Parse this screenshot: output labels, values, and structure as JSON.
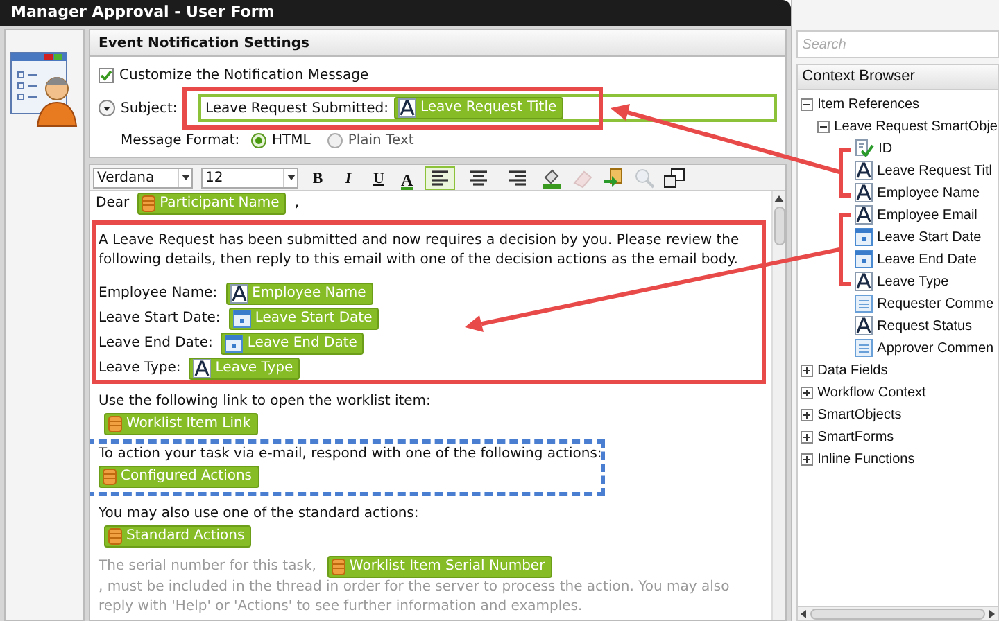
{
  "window": {
    "title": "Manager Approval - User Form"
  },
  "section_title": "Event Notification Settings",
  "customize": {
    "label": "Customize the Notification Message",
    "checked": true
  },
  "subject": {
    "label": "Subject:",
    "prefix": "Leave Request Submitted:",
    "token": {
      "label": "Leave Request Title",
      "kind": "text"
    }
  },
  "message_format": {
    "label": "Message Format:",
    "options": [
      {
        "label": "HTML",
        "selected": true
      },
      {
        "label": "Plain Text",
        "selected": false
      }
    ]
  },
  "toolbar": {
    "font": "Verdana",
    "size": "12",
    "styles": [
      "B",
      "I",
      "U"
    ],
    "color_button": "A",
    "alignment": [
      {
        "selected": true
      },
      {
        "selected": false
      },
      {
        "selected": false
      }
    ],
    "tools": [
      {
        "kind": "fill",
        "disabled": false
      },
      {
        "kind": "eraser",
        "disabled": true
      },
      {
        "kind": "insert",
        "disabled": false
      },
      {
        "kind": "zoom",
        "disabled": true
      },
      {
        "kind": "popout",
        "disabled": false
      }
    ]
  },
  "body": {
    "greeting": "Dear",
    "greeting_token": {
      "label": "Participant Name",
      "kind": "data"
    },
    "greeting_end": ",",
    "intro": "A Leave Request has been submitted and now requires a decision by you. Please review the following details, then reply to this email with one of the decision actions as the email body.",
    "fields": [
      {
        "label": "Employee Name:",
        "token": {
          "label": "Employee Name",
          "kind": "text"
        }
      },
      {
        "label": "Leave Start Date:",
        "token": {
          "label": "Leave Start Date",
          "kind": "date"
        }
      },
      {
        "label": "Leave End Date:",
        "token": {
          "label": "Leave End Date",
          "kind": "date"
        }
      },
      {
        "label": "Leave Type:",
        "token": {
          "label": "Leave Type",
          "kind": "text"
        }
      }
    ],
    "sections": [
      {
        "text": "Use the following link to open the worklist item:",
        "token": {
          "label": "Worklist Item Link",
          "kind": "data"
        }
      },
      {
        "text": "To action your task via e-mail, respond with one of the following actions:",
        "token": {
          "label": "Configured Actions",
          "kind": "data"
        }
      },
      {
        "text": "You may also use one of the standard actions:",
        "token": {
          "label": "Standard Actions",
          "kind": "data"
        }
      }
    ],
    "serial_before": "The serial number for this task,",
    "serial_token": {
      "label": "Worklist Item Serial Number",
      "kind": "data"
    },
    "serial_after": ", must be included in the thread in order for the server to process the action. You may also reply with 'Help' or 'Actions' to see further information and examples."
  },
  "context": {
    "search": {
      "placeholder": "Search"
    },
    "title": "Context Browser",
    "tree": [
      {
        "label": "Item References",
        "kind": "group",
        "expanded": true,
        "children": [
          {
            "label": "Leave Request SmartObje",
            "kind": "group",
            "expanded": true,
            "children": [
              {
                "label": "ID",
                "kind": "key"
              },
              {
                "label": "Leave Request Titl",
                "kind": "text"
              },
              {
                "label": "Employee Name",
                "kind": "text"
              },
              {
                "label": "Employee Email",
                "kind": "text"
              },
              {
                "label": "Leave Start Date",
                "kind": "date"
              },
              {
                "label": "Leave End Date",
                "kind": "date"
              },
              {
                "label": "Leave Type",
                "kind": "text"
              },
              {
                "label": "Requester Comme",
                "kind": "memo"
              },
              {
                "label": "Request Status",
                "kind": "text"
              },
              {
                "label": "Approver Commen",
                "kind": "memo"
              }
            ]
          }
        ]
      },
      {
        "label": "Data Fields",
        "kind": "group",
        "expanded": false
      },
      {
        "label": "Workflow Context",
        "kind": "group",
        "expanded": false
      },
      {
        "label": "SmartObjects",
        "kind": "group",
        "expanded": false
      },
      {
        "label": "SmartForms",
        "kind": "group",
        "expanded": false
      },
      {
        "label": "Inline Functions",
        "kind": "group",
        "expanded": false
      }
    ]
  }
}
